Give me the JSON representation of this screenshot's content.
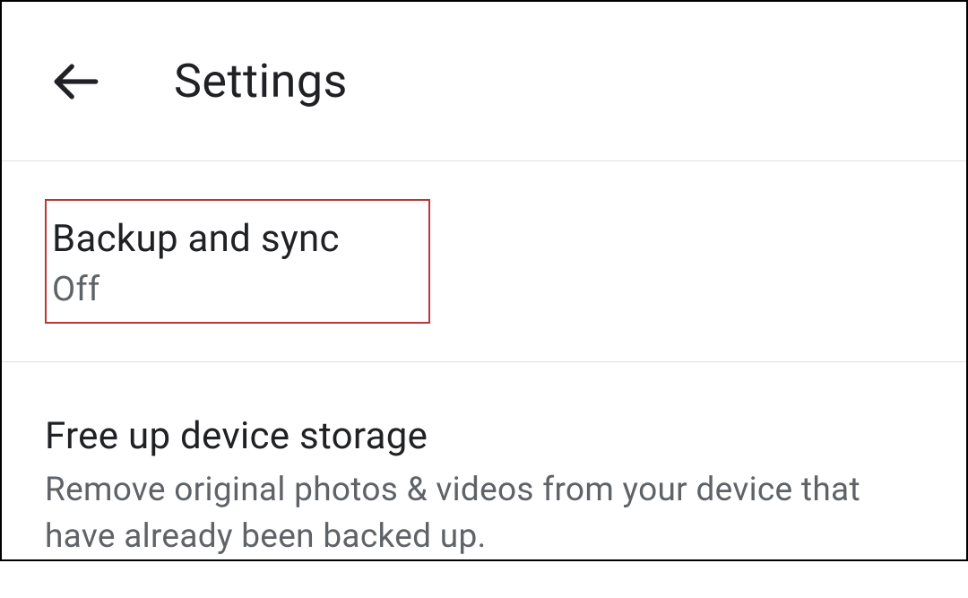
{
  "header": {
    "title": "Settings"
  },
  "settings": {
    "backup_sync": {
      "title": "Backup and sync",
      "status": "Off"
    },
    "free_up_storage": {
      "title": "Free up device storage",
      "description": "Remove original photos & videos from your device that have already been backed up."
    }
  }
}
